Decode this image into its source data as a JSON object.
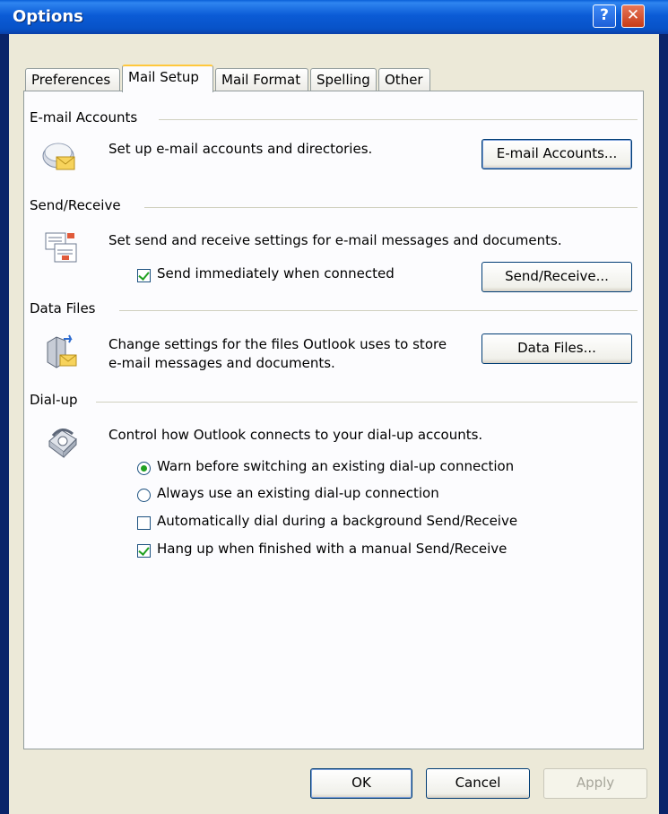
{
  "window": {
    "title": "Options"
  },
  "tabs": [
    {
      "label": "Preferences"
    },
    {
      "label": "Mail Setup"
    },
    {
      "label": "Mail Format"
    },
    {
      "label": "Spelling"
    },
    {
      "label": "Other"
    }
  ],
  "email_accounts": {
    "heading": "E-mail Accounts",
    "description": "Set up e-mail accounts and directories.",
    "button": "E-mail Accounts..."
  },
  "send_receive": {
    "heading": "Send/Receive",
    "description": "Set send and receive settings for e-mail messages and documents.",
    "checkbox_label": "Send immediately when connected",
    "checkbox_checked": true,
    "button": "Send/Receive..."
  },
  "data_files": {
    "heading": "Data Files",
    "description_line1": "Change settings for the files Outlook uses to store",
    "description_line2": "e-mail messages and documents.",
    "button": "Data Files..."
  },
  "dialup": {
    "heading": "Dial-up",
    "description": "Control how Outlook connects to your dial-up accounts.",
    "radio1": "Warn before switching an existing dial-up connection",
    "radio2": "Always use an existing dial-up connection",
    "check1": "Automatically dial during a background Send/Receive",
    "check2": "Hang up when finished with a manual Send/Receive"
  },
  "footer": {
    "ok": "OK",
    "cancel": "Cancel",
    "apply": "Apply"
  }
}
